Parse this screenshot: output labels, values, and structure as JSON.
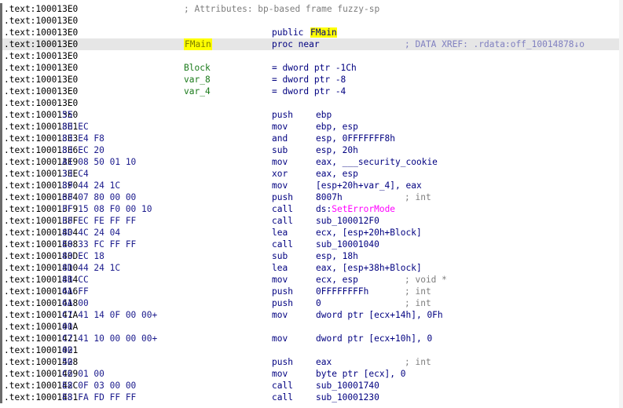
{
  "listing": {
    "rows": [
      {
        "addr": ".text:100013E0",
        "hdrcmt": "; Attributes: bp-based frame fuzzy-sp"
      },
      {
        "addr": ".text:100013E0"
      },
      {
        "addr": ".text:100013E0",
        "mnem": "public ",
        "ops_pre": "",
        "ops_hl": "FMain",
        "ops_post": ""
      },
      {
        "addr": ".text:100013E0",
        "label": "FMain",
        "mnem": "proc near",
        "xref": "; DATA XREF: .rdata:off_10014878↓o",
        "selected": true
      },
      {
        "addr": ".text:100013E0"
      },
      {
        "addr": ".text:100013E0",
        "label": "Block",
        "mnem": "= dword ptr -1Ch"
      },
      {
        "addr": ".text:100013E0",
        "label": "var_8",
        "mnem": "= dword ptr -8"
      },
      {
        "addr": ".text:100013E0",
        "label": "var_4",
        "mnem": "= dword ptr -4"
      },
      {
        "addr": ".text:100013E0"
      },
      {
        "addr": ".text:100013E0",
        "bytes": "55",
        "mnem": "push",
        "ops": "ebp"
      },
      {
        "addr": ".text:100013E1",
        "bytes": "8B EC",
        "mnem": "mov",
        "ops": "ebp, esp"
      },
      {
        "addr": ".text:100013E3",
        "bytes": "83 E4 F8",
        "mnem": "and",
        "ops": "esp, 0FFFFFFF8h"
      },
      {
        "addr": ".text:100013E6",
        "bytes": "83 EC 20",
        "mnem": "sub",
        "ops": "esp, 20h"
      },
      {
        "addr": ".text:100013E9",
        "bytes": "A1 08 50 01 10",
        "mnem": "mov",
        "ops": "eax, ___security_cookie"
      },
      {
        "addr": ".text:100013EE",
        "bytes": "33 C4",
        "mnem": "xor",
        "ops": "eax, esp"
      },
      {
        "addr": ".text:100013F0",
        "bytes": "89 44 24 1C",
        "mnem": "mov",
        "ops": "[esp+20h+var_4], eax"
      },
      {
        "addr": ".text:100013F4",
        "bytes": "68 07 80 00 00",
        "mnem": "push",
        "ops": "8007h",
        "cmt": "; int"
      },
      {
        "addr": ".text:100013F9",
        "bytes": "FF 15 08 F0 00 10",
        "mnem": "call",
        "ops_pre": "ds:",
        "ops_api": "SetErrorMode"
      },
      {
        "addr": ".text:100013FF",
        "bytes": "E8 EC FE FF FF",
        "mnem": "call",
        "ops": "sub_100012F0"
      },
      {
        "addr": ".text:10001404",
        "bytes": "8D 4C 24 04",
        "mnem": "lea",
        "ops": "ecx, [esp+20h+Block]"
      },
      {
        "addr": ".text:10001408",
        "bytes": "E8 33 FC FF FF",
        "mnem": "call",
        "ops": "sub_10001040"
      },
      {
        "addr": ".text:1000140D",
        "bytes": "83 EC 18",
        "mnem": "sub",
        "ops": "esp, 18h"
      },
      {
        "addr": ".text:10001410",
        "bytes": "8D 44 24 1C",
        "mnem": "lea",
        "ops": "eax, [esp+38h+Block]"
      },
      {
        "addr": ".text:10001414",
        "bytes": "8B CC",
        "mnem": "mov",
        "ops": "ecx, esp",
        "cmt": "; void *"
      },
      {
        "addr": ".text:10001416",
        "bytes": "6A FF",
        "mnem": "push",
        "ops": "0FFFFFFFFh",
        "cmt": "; int"
      },
      {
        "addr": ".text:10001418",
        "bytes": "6A 00",
        "mnem": "push",
        "ops": "0",
        "cmt": "; int"
      },
      {
        "addr": ".text:1000141A",
        "bytes": "C7 41 14 0F 00 00+",
        "mnem": "mov",
        "ops": "dword ptr [ecx+14h], 0Fh"
      },
      {
        "addr": ".text:1000141A",
        "bytes": "00"
      },
      {
        "addr": ".text:10001421",
        "bytes": "C7 41 10 00 00 00+",
        "mnem": "mov",
        "ops": "dword ptr [ecx+10h], 0"
      },
      {
        "addr": ".text:10001421",
        "bytes": "00"
      },
      {
        "addr": ".text:10001428",
        "bytes": "50",
        "mnem": "push",
        "ops": "eax",
        "cmt": "; int"
      },
      {
        "addr": ".text:10001429",
        "bytes": "C6 01 00",
        "mnem": "mov",
        "ops": "byte ptr [ecx], 0"
      },
      {
        "addr": ".text:1000142C",
        "bytes": "E8 0F 03 00 00",
        "mnem": "call",
        "ops": "sub_10001740"
      },
      {
        "addr": ".text:10001431",
        "bytes": "E8 FA FD FF FF",
        "mnem": "call",
        "ops": "sub_10001230"
      }
    ]
  }
}
